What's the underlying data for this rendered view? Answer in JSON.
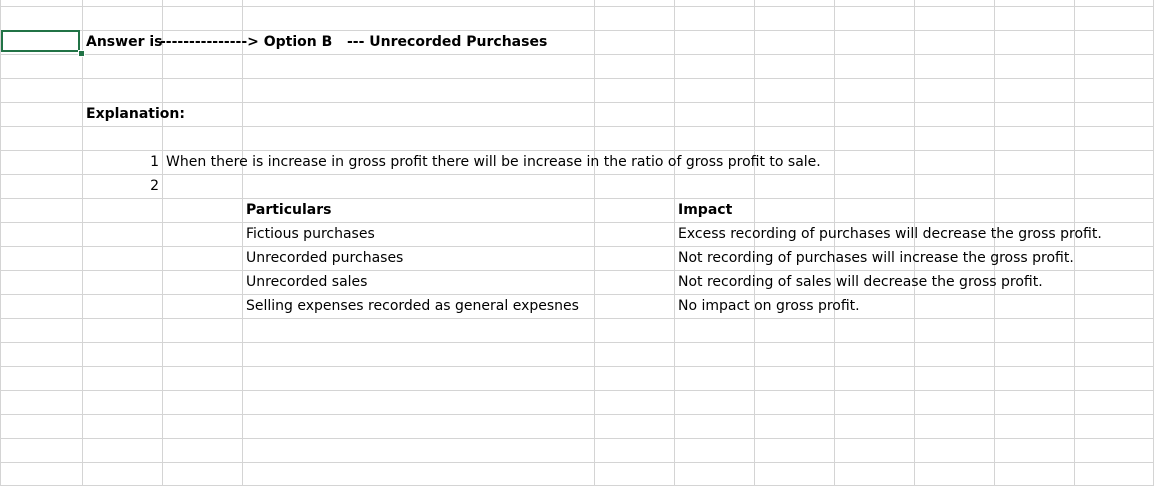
{
  "sheet": {
    "answer_label": "Answer is",
    "answer_arrow": "---------------> Option B",
    "answer_detail": "--- Unrecorded Purchases",
    "explanation_heading": "Explanation:",
    "points": [
      {
        "number": "1",
        "text": "When there is increase in gross profit there will be increase in the ratio of gross profit to sale."
      },
      {
        "number": "2",
        "text": ""
      }
    ],
    "table": {
      "headers": {
        "particulars": "Particulars",
        "impact": "Impact"
      },
      "rows": [
        {
          "particulars": "Fictious purchases",
          "impact": "Excess recording of purchases will decrease the gross profit."
        },
        {
          "particulars": "Unrecorded purchases",
          "impact": "Not recording of purchases will increase the gross profit."
        },
        {
          "particulars": "Unrecorded sales",
          "impact": "Not recording of sales will decrease the gross profit."
        },
        {
          "particulars": "Selling expenses recorded as general expesnes",
          "impact": "No impact on gross profit."
        }
      ]
    }
  }
}
